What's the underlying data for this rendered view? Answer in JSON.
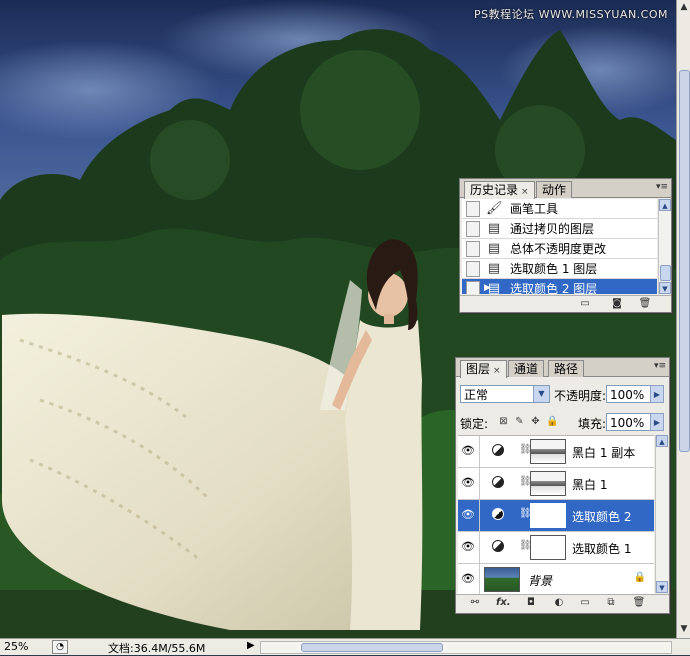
{
  "watermark": "PS教程论坛 WWW.MISSYUAN.COM",
  "history_panel": {
    "tabs": [
      {
        "label": "历史记录",
        "active": true,
        "close": "×"
      },
      {
        "label": "动作",
        "active": false
      }
    ],
    "menu": "▾≡",
    "items": [
      {
        "label": "画笔工具",
        "icon": "brush-icon"
      },
      {
        "label": "通过拷贝的图层",
        "icon": "history-state-icon"
      },
      {
        "label": "总体不透明度更改",
        "icon": "history-state-icon"
      },
      {
        "label": "选取颜色 1 图层",
        "icon": "history-state-icon"
      },
      {
        "label": "选取颜色 2 图层",
        "icon": "history-state-icon",
        "selected": true
      }
    ]
  },
  "layers_panel": {
    "tabs": [
      {
        "label": "图层",
        "active": true,
        "close": "×"
      },
      {
        "label": "通道",
        "active": false
      },
      {
        "label": "路径",
        "active": false
      }
    ],
    "menu": "▾≡",
    "blend_mode": "正常",
    "opacity_label": "不透明度:",
    "opacity_value": "100%",
    "lock_label": "锁定:",
    "fill_label": "填充:",
    "fill_value": "100%",
    "layers": [
      {
        "name": "黑白 1 副本",
        "type": "adjustment",
        "mask": "bw",
        "visible": true
      },
      {
        "name": "黑白 1",
        "type": "adjustment",
        "mask": "bw",
        "visible": true
      },
      {
        "name": "选取颜色 2",
        "type": "adjustment",
        "mask": "white",
        "visible": true,
        "selected": true
      },
      {
        "name": "选取颜色 1",
        "type": "adjustment",
        "mask": "white",
        "visible": true
      },
      {
        "name": "背景",
        "type": "background",
        "visible": true,
        "locked": true
      }
    ],
    "footer_fx": "fx."
  },
  "status_bar": {
    "zoom": "25%",
    "doc_info": "文档:36.4M/55.6M"
  },
  "colors": {
    "selection": "#3168c5",
    "panel_bg": "#ecebe5"
  }
}
